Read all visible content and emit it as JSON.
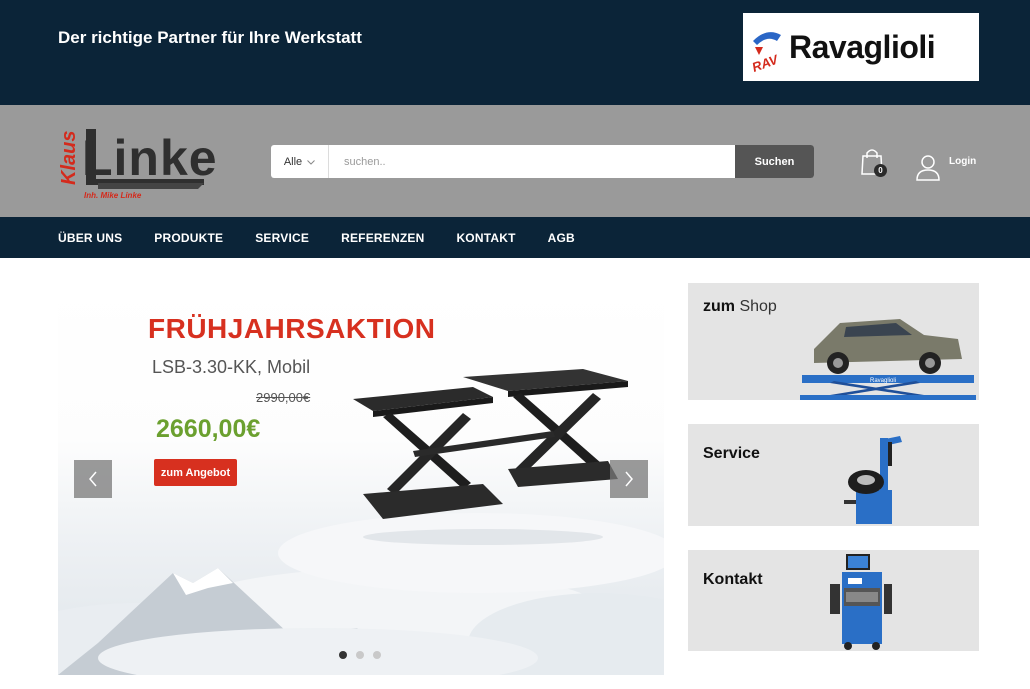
{
  "topbar": {
    "tagline": "Der richtige Partner für Ihre Werkstatt",
    "brand_name": "Ravaglioli",
    "brand_mark_text": "RAV"
  },
  "logo": {
    "first_name": "Klaus",
    "last_name": "Linke",
    "subtitle": "Inh. Mike Linke"
  },
  "search": {
    "category": "Alle",
    "placeholder": "suchen..",
    "button_label": "Suchen"
  },
  "cart": {
    "count": "0"
  },
  "account": {
    "login_label": "Login"
  },
  "nav": {
    "items": [
      "ÜBER UNS",
      "PRODUKTE",
      "SERVICE",
      "REFERENZEN",
      "KONTAKT",
      "AGB"
    ]
  },
  "slider": {
    "title": "FRÜHJAHRSAKTION",
    "model": "LSB-3.30-KK, Mobil",
    "old_price": "2990,00€",
    "price": "2660,00€",
    "cta_label": "zum Angebot",
    "total_slides": 3,
    "active_slide": 1
  },
  "cards": {
    "shop_strong": "zum",
    "shop_light": "Shop",
    "service_title": "Service",
    "kontakt_title": "Kontakt",
    "lift_brand": "Ravaglioli"
  },
  "colors": {
    "navy": "#0b2438",
    "header_gray": "#9a9a9a",
    "accent_red": "#d7301f",
    "price_green": "#6ba02f",
    "card_gray": "#e4e4e4"
  },
  "icons": [
    "chevron-down-icon",
    "shopping-bag-icon",
    "user-icon",
    "chevron-left-icon",
    "chevron-right-icon"
  ]
}
